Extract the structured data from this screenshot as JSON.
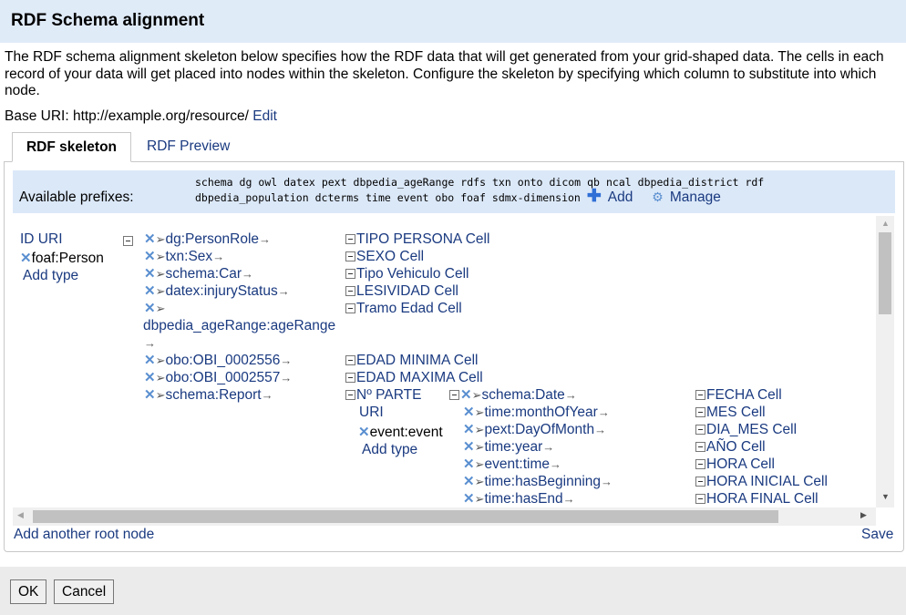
{
  "header": {
    "title": "RDF Schema alignment"
  },
  "description": "The RDF schema alignment skeleton below specifies how the RDF data that will get generated from your grid-shaped data. The cells in each record of your data will get placed into nodes within the skeleton. Configure the skeleton by specifying which column to substitute into which node.",
  "base_uri": {
    "label": "Base URI:",
    "value": "http://example.org/resource/",
    "edit": "Edit"
  },
  "tabs": [
    {
      "label": "RDF skeleton"
    },
    {
      "label": "RDF Preview"
    }
  ],
  "prefixes": {
    "label": "Available prefixes:",
    "row1": [
      "schema",
      "dg",
      "owl",
      "datex",
      "pext",
      "dbpedia_ageRange",
      "rdfs",
      "txn",
      "onto",
      "dicom",
      "qb",
      "ncal",
      "dbpedia_district",
      "rdf"
    ],
    "row2": [
      "dbpedia_population",
      "dcterms",
      "time",
      "event",
      "obo",
      "foaf",
      "sdmx-dimension"
    ],
    "add": "Add",
    "manage": "Manage"
  },
  "skeleton": {
    "root": {
      "label": "ID URI",
      "type": "foaf:Person",
      "add_type": "Add type"
    },
    "links": [
      {
        "prop": "dg:PersonRole",
        "target": "TIPO PERSONA Cell"
      },
      {
        "prop": "txn:Sex",
        "target": "SEXO Cell"
      },
      {
        "prop": "schema:Car",
        "target": "Tipo Vehiculo Cell"
      },
      {
        "prop": "datex:injuryStatus",
        "target": "LESIVIDAD Cell"
      },
      {
        "prop": "dbpedia_ageRange:ageRange",
        "target": "Tramo Edad Cell"
      },
      {
        "prop": "obo:OBI_0002556",
        "target": "EDAD MINIMA Cell"
      },
      {
        "prop": "obo:OBI_0002557",
        "target": "EDAD MAXIMA Cell"
      },
      {
        "prop": "schema:Report",
        "target": "Nº PARTE"
      }
    ],
    "report_node": {
      "uri": "URI",
      "type": "event:event",
      "add_type": "Add type"
    },
    "sublinks": [
      {
        "prop": "schema:Date",
        "target": "FECHA Cell"
      },
      {
        "prop": "time:monthOfYear",
        "target": "MES Cell"
      },
      {
        "prop": "pext:DayOfMonth",
        "target": "DIA_MES Cell"
      },
      {
        "prop": "time:year",
        "target": "AÑO Cell"
      },
      {
        "prop": "event:time",
        "target": "HORA Cell"
      },
      {
        "prop": "time:hasBeginning",
        "target": "HORA INICIAL Cell"
      },
      {
        "prop": "time:hasEnd",
        "target": "HORA FINAL Cell"
      }
    ]
  },
  "add_root": "Add another root node",
  "save": "Save",
  "footer": {
    "ok": "OK",
    "cancel": "Cancel"
  }
}
